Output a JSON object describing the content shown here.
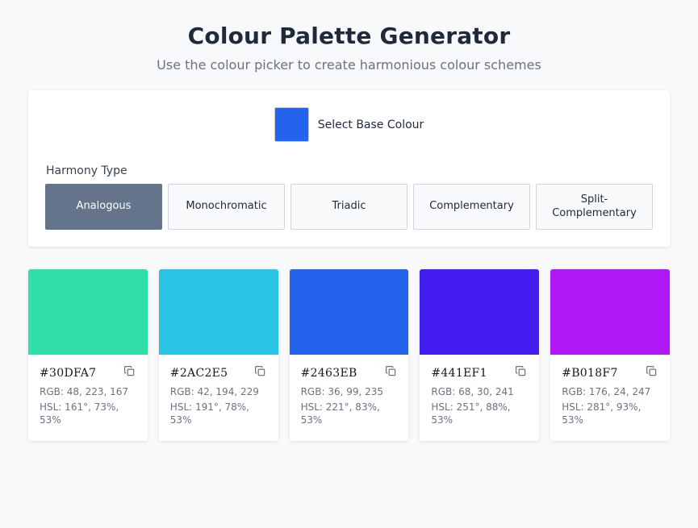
{
  "header": {
    "title": "Colour Palette Generator",
    "subtitle": "Use the colour picker to create harmonious colour schemes"
  },
  "picker": {
    "label": "Select Base Colour",
    "value": "#2463EB"
  },
  "harmony": {
    "label": "Harmony Type",
    "selected": "Analogous",
    "options": [
      "Analogous",
      "Monochromatic",
      "Triadic",
      "Complementary",
      "Split-Complementary"
    ]
  },
  "palette": [
    {
      "hex": "#30DFA7",
      "rgb": "RGB: 48, 223, 167",
      "hsl": "HSL: 161°, 73%, 53%"
    },
    {
      "hex": "#2AC2E5",
      "rgb": "RGB: 42, 194, 229",
      "hsl": "HSL: 191°, 78%, 53%"
    },
    {
      "hex": "#2463EB",
      "rgb": "RGB: 36, 99, 235",
      "hsl": "HSL: 221°, 83%, 53%"
    },
    {
      "hex": "#441EF1",
      "rgb": "RGB: 68, 30, 241",
      "hsl": "HSL: 251°, 88%, 53%"
    },
    {
      "hex": "#B018F7",
      "rgb": "RGB: 176, 24, 247",
      "hsl": "HSL: 281°, 93%, 53%"
    }
  ],
  "icons": {
    "copy": "copy-icon"
  }
}
